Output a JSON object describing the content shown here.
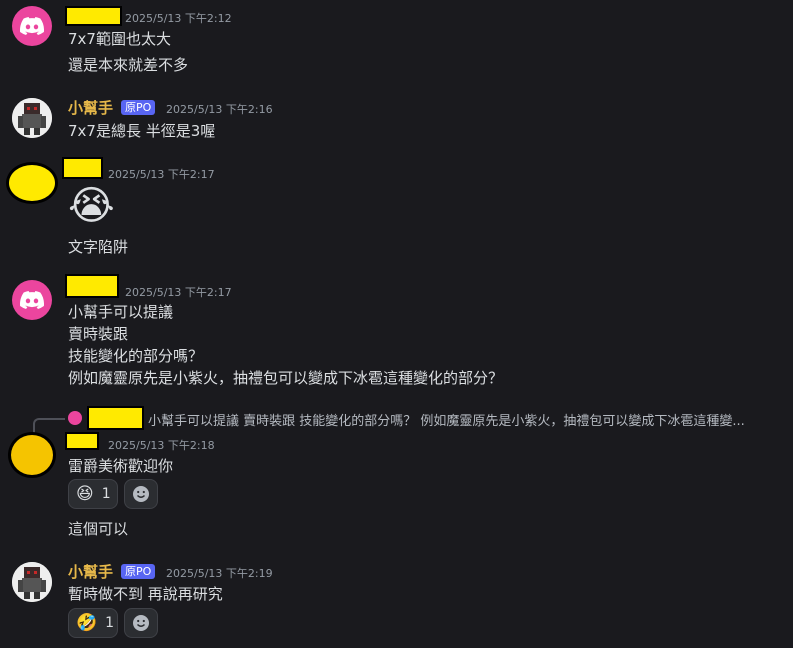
{
  "messages": [
    {
      "id": "m1",
      "author": "",
      "timestamp": "2025/5/13 下午2:12",
      "lines": [
        "7x7範圍也太大",
        "還是本來就差不多"
      ]
    },
    {
      "id": "m2",
      "author": "小幫手",
      "badge": "原PO",
      "timestamp": "2025/5/13 下午2:16",
      "lines": [
        "7x7是總長 半徑是3喔"
      ]
    },
    {
      "id": "m3",
      "author": "",
      "timestamp": "2025/5/13 下午2:17",
      "emoji": "😭",
      "lines": [
        "文字陷阱"
      ]
    },
    {
      "id": "m4",
      "author": "",
      "timestamp": "2025/5/13 下午2:17",
      "lines": [
        "小幫手可以提議",
        "賣時裝跟",
        "技能變化的部分嗎？",
        "例如魔靈原先是小紫火，抽禮包可以變成下冰雹這種變化的部分？"
      ]
    },
    {
      "id": "m5",
      "reply_preview": "小幫手可以提議  賣時裝跟 技能變化的部分嗎？ 例如魔靈原先是小紫火，抽禮包可以變成下冰雹這種變...",
      "author": "",
      "timestamp": "2025/5/13 下午2:18",
      "lines": [
        "雷爵美術歡迎你"
      ],
      "reaction": {
        "emoji": "😆",
        "count": "1"
      },
      "extra_line": "這個可以"
    },
    {
      "id": "m6",
      "author": "小幫手",
      "badge": "原PO",
      "timestamp": "2025/5/13 下午2:19",
      "lines": [
        "暫時做不到 再說再研究"
      ],
      "reaction": {
        "emoji": "🤣",
        "count": "1"
      }
    }
  ],
  "icons": {
    "discord_logo": "discord-icon",
    "add_reaction": "smile-icon"
  },
  "colors": {
    "background": "#1a1a1e",
    "username_gold": "#e6b84a",
    "badge_blue": "#5865f2",
    "discord_pink": "#eb459e",
    "redaction": "#ffea00"
  }
}
